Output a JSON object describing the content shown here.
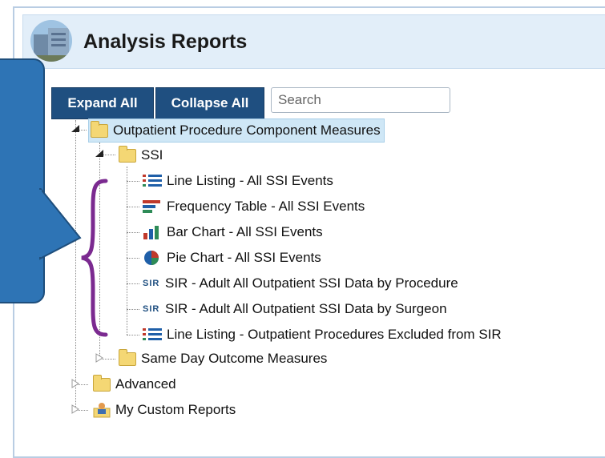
{
  "header": {
    "title": "Analysis Reports"
  },
  "toolbar": {
    "expand_all": "Expand All",
    "collapse_all": "Collapse All",
    "search_placeholder": "Search"
  },
  "tree": {
    "root": "Outpatient Procedure Component Measures",
    "ssi": "SSI",
    "reports": [
      {
        "label": "Line Listing - All SSI Events",
        "icon": "line-listing-icon"
      },
      {
        "label": "Frequency Table - All SSI Events",
        "icon": "frequency-table-icon"
      },
      {
        "label": "Bar Chart - All SSI Events",
        "icon": "bar-chart-icon"
      },
      {
        "label": "Pie Chart - All SSI Events",
        "icon": "pie-chart-icon"
      },
      {
        "label": "SIR - Adult All Outpatient SSI Data by Procedure",
        "icon": "sir-icon",
        "tag": "SIR"
      },
      {
        "label": "SIR - Adult All Outpatient SSI Data by Surgeon",
        "icon": "sir-icon",
        "tag": "SIR"
      },
      {
        "label": "Line Listing - Outpatient Procedures Excluded from SIR",
        "icon": "line-listing-icon"
      }
    ],
    "same_day": "Same Day Outcome Measures",
    "advanced": "Advanced",
    "custom": "My Custom Reports"
  },
  "colors": {
    "button": "#1f4f80",
    "header_bg": "#e2eef9",
    "highlight": "#cfe7f6",
    "brace": "#7b2a90",
    "callout": "#2e74b5"
  }
}
